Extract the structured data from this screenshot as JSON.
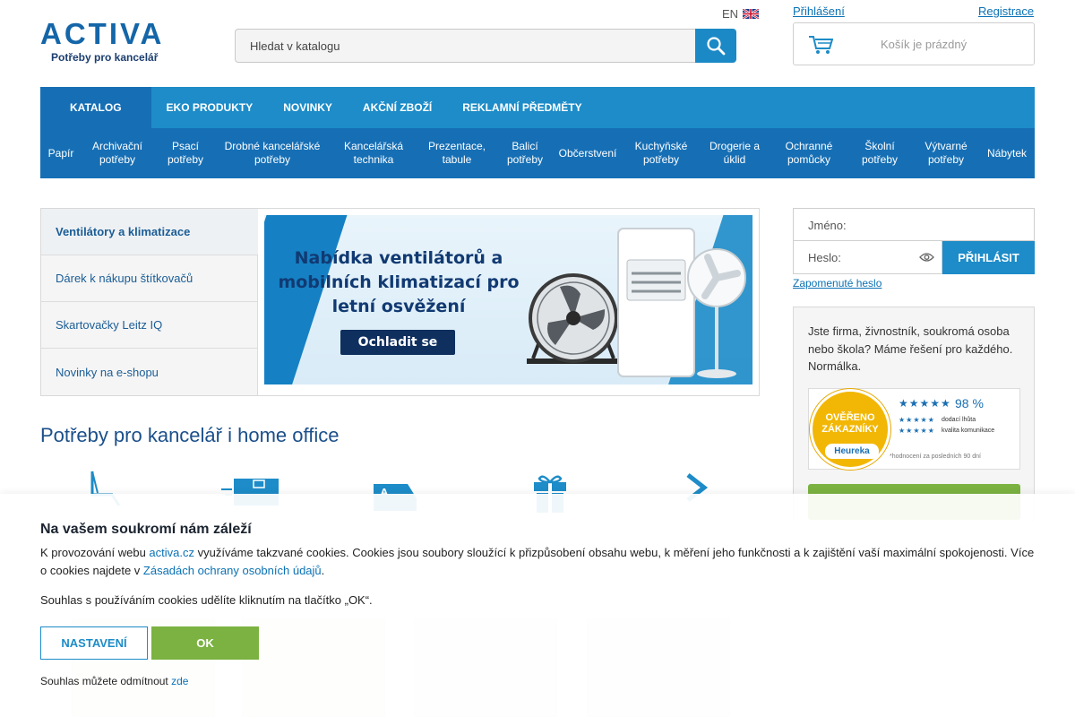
{
  "brand": {
    "logo_text": "ACTIVA",
    "tagline": "Potřeby pro kancelář"
  },
  "search": {
    "placeholder": "Hledat v katalogu"
  },
  "header": {
    "language": "EN",
    "login_link": "Přihlášení",
    "register_link": "Registrace",
    "cart_status": "Košík je prázdný"
  },
  "topnav": [
    {
      "label": "KATALOG"
    },
    {
      "label": "EKO PRODUKTY"
    },
    {
      "label": "NOVINKY"
    },
    {
      "label": "AKČNÍ ZBOŽÍ"
    },
    {
      "label": "REKLAMNÍ PŘEDMĚTY"
    }
  ],
  "subnav": [
    {
      "label": "Papír"
    },
    {
      "label": "Archivační potřeby"
    },
    {
      "label": "Psací potřeby"
    },
    {
      "label": "Drobné kancelářské potřeby"
    },
    {
      "label": "Kancelářská technika"
    },
    {
      "label": "Prezentace, tabule"
    },
    {
      "label": "Balicí potřeby"
    },
    {
      "label": "Občerstvení"
    },
    {
      "label": "Kuchyňské potřeby"
    },
    {
      "label": "Drogerie a úklid"
    },
    {
      "label": "Ochranné pomůcky"
    },
    {
      "label": "Školní potřeby"
    },
    {
      "label": "Výtvarné potřeby"
    },
    {
      "label": "Nábytek"
    }
  ],
  "promo": {
    "items": [
      {
        "label": "Ventilátory a klimatizace"
      },
      {
        "label": "Dárek k nákupu štítkovačů"
      },
      {
        "label": "Skartovačky Leitz IQ"
      },
      {
        "label": "Novinky na e-shopu"
      }
    ],
    "banner_title": "Nabídka ventilátorů a mobilních klimatizací pro letní osvěžení",
    "banner_cta": "Ochladit se"
  },
  "main": {
    "heading": "Potřeby pro kancelář i home office"
  },
  "login": {
    "name_label": "Jméno:",
    "password_label": "Heslo:",
    "submit": "PŘIHLÁSIT",
    "forgot": "Zapomenuté heslo"
  },
  "info": {
    "text": "Jste firma, živnostník, soukromá osoba nebo škola? Máme řešení pro každého. Normálka."
  },
  "heureka": {
    "seal_text": "OVĚŘENO ZÁKAZNÍKY",
    "seal_brand": "Heureka",
    "stars": "★★★★★",
    "percent": "98 %",
    "row1_label": "dodací lhůta",
    "row2_label": "kvalita komunikace",
    "note": "*hodnocení za posledních 90 dní"
  },
  "cookie": {
    "title": "Na vašem soukromí nám záleží",
    "body_part1": "K provozování webu ",
    "body_link1": "activa.cz",
    "body_part2": " využíváme takzvané cookies. Cookies jsou soubory sloužící k přizpůsobení obsahu webu, k měření jeho funkčnosti a k zajištění vaší maximální spokojenosti. Více o cookies najdete v ",
    "body_link2": "Zásadách ochrany osobních údajů",
    "body_part3": ".",
    "consent": "Souhlas s používáním cookies udělíte kliknutím na tlačítko „OK“.",
    "settings_button": "NASTAVENÍ",
    "ok_button": "OK",
    "decline_text": "Souhlas můžete odmítnout ",
    "decline_link": "zde"
  },
  "colors": {
    "primary_blue": "#1d8cc8",
    "dark_blue": "#166fb5",
    "green": "#7bb241",
    "heading_blue": "#1b4f8a"
  }
}
